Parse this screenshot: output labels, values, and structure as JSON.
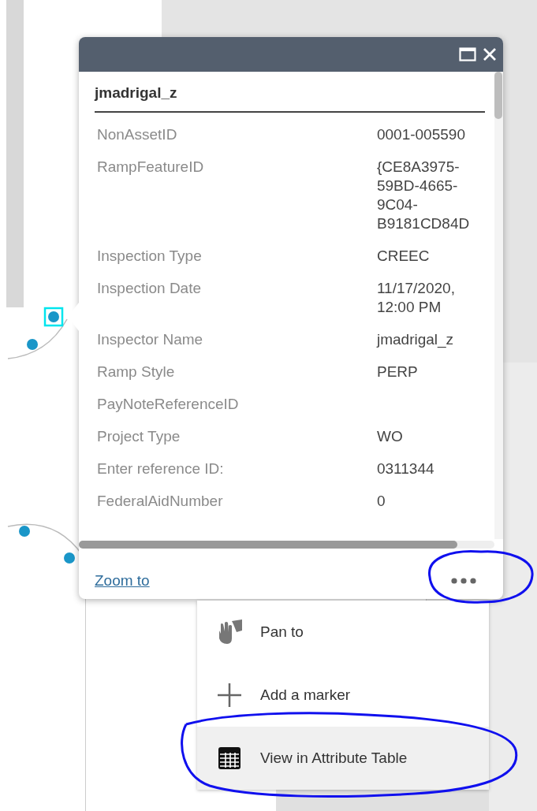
{
  "popup": {
    "title": "jmadrigal_z",
    "fields": [
      {
        "label": "NonAssetID",
        "value": "0001-005590"
      },
      {
        "label": "RampFeatureID",
        "value": "{CE8A3975-59BD-4665-9C04-B9181CD84D"
      },
      {
        "label": "Inspection Type",
        "value": "CREEC"
      },
      {
        "label": "Inspection Date",
        "value": "11/17/2020, 12:00 PM"
      },
      {
        "label": "Inspector Name",
        "value": "jmadrigal_z"
      },
      {
        "label": "Ramp Style",
        "value": "PERP"
      },
      {
        "label": "PayNoteReferenceID"
      },
      {
        "label": "Project Type",
        "value": "WO"
      },
      {
        "label": "Enter reference ID:",
        "value": "0311344"
      },
      {
        "label": "FederalAidNumber",
        "value": "0"
      }
    ],
    "zoom_link": "Zoom to"
  },
  "actions_menu": {
    "items": [
      {
        "kind": "pan",
        "label": "Pan to",
        "selected": false
      },
      {
        "kind": "marker",
        "label": "Add a marker",
        "selected": false
      },
      {
        "kind": "table",
        "label": "View in Attribute Table",
        "selected": true
      }
    ]
  }
}
